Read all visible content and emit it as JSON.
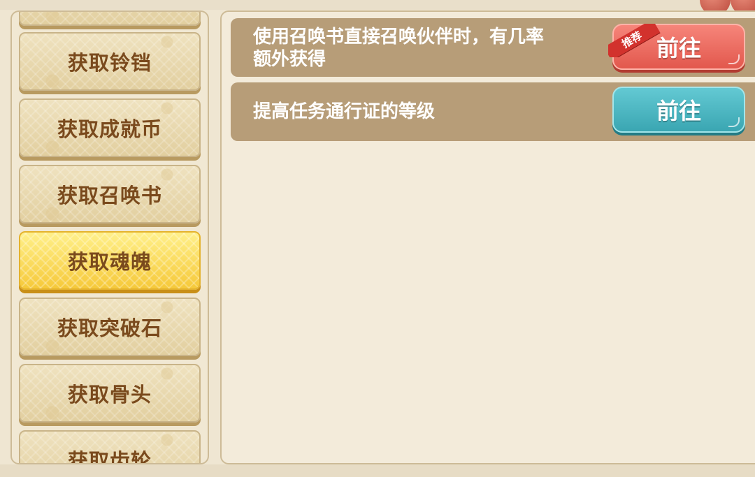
{
  "sidebar": {
    "items": [
      {
        "label": ""
      },
      {
        "label": "获取铃铛"
      },
      {
        "label": "获取成就币"
      },
      {
        "label": "获取召唤书"
      },
      {
        "label": "获取魂魄"
      },
      {
        "label": "获取突破石"
      },
      {
        "label": "获取骨头"
      },
      {
        "label": "获取齿轮"
      }
    ],
    "active_index": 4
  },
  "tasks": [
    {
      "text_line1": "使用召唤书直接召唤伙伴时，有几率",
      "text_line2": "额外获得",
      "button_label": "前往",
      "button_color": "#e95f54",
      "badge": "推荐"
    },
    {
      "text_line1": "提高任务通行证的等级",
      "button_label": "前往",
      "button_color": "#44b0bb"
    }
  ]
}
